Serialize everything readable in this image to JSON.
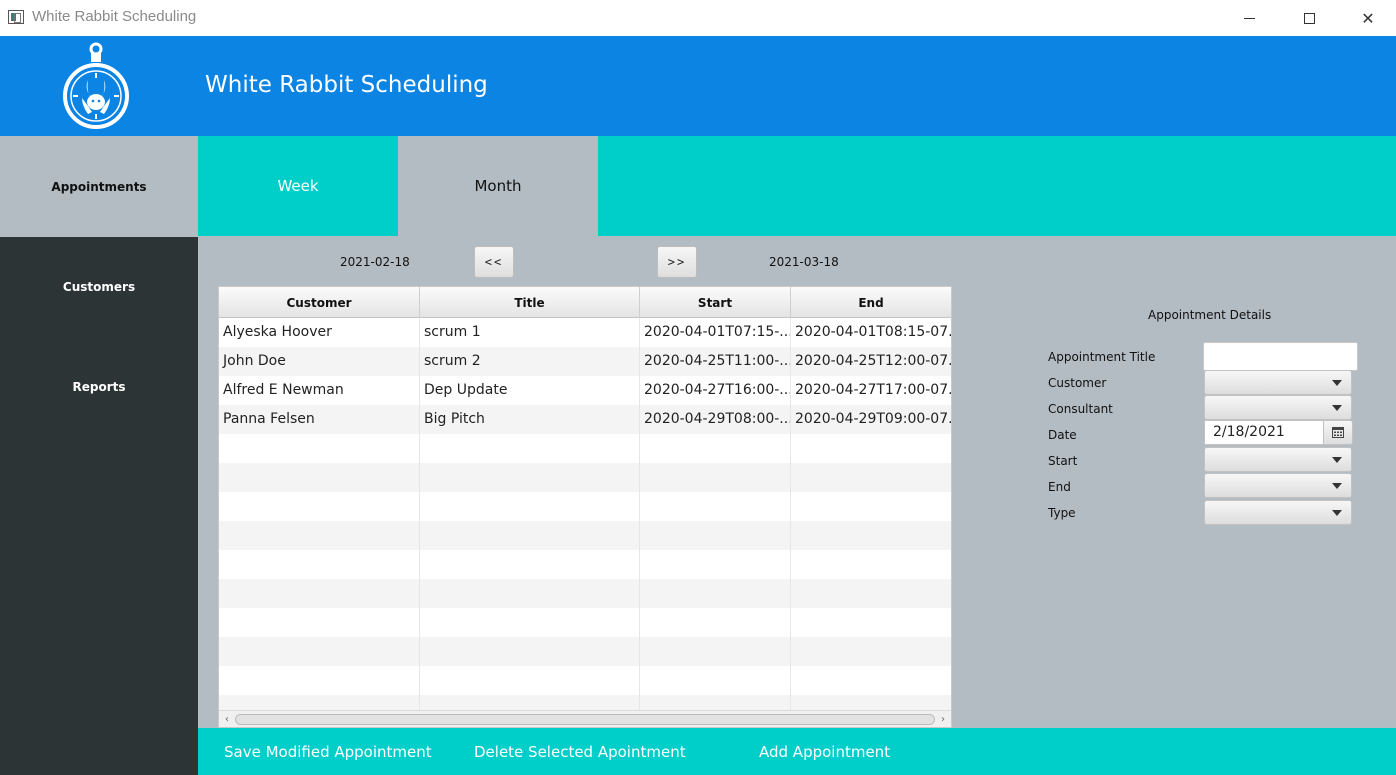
{
  "window": {
    "title": "White Rabbit Scheduling",
    "minimize_glyph": "—",
    "maximize_glyph": "☐",
    "close_glyph": "✕"
  },
  "header": {
    "title": "White Rabbit Scheduling",
    "logo_icon": "pocket-watch-rabbit-icon"
  },
  "sidebar": {
    "items": [
      {
        "label": "Appointments"
      },
      {
        "label": "Customers"
      },
      {
        "label": "Reports"
      }
    ]
  },
  "tabs": [
    {
      "label": "Week"
    },
    {
      "label": "Month"
    }
  ],
  "range": {
    "start": "2021-02-18",
    "end": "2021-03-18",
    "prev_label": "<<",
    "next_label": ">>"
  },
  "table": {
    "columns": [
      "Customer",
      "Title",
      "Start",
      "End"
    ],
    "rows": [
      [
        "Alyeska Hoover",
        "scrum 1",
        "2020-04-01T07:15-...",
        "2020-04-01T08:15-07..."
      ],
      [
        "John Doe",
        "scrum 2",
        "2020-04-25T11:00-...",
        "2020-04-25T12:00-07..."
      ],
      [
        "Alfred E Newman",
        "Dep Update",
        "2020-04-27T16:00-...",
        "2020-04-27T17:00-07..."
      ],
      [
        "Panna Felsen",
        "Big Pitch",
        "2020-04-29T08:00-...",
        "2020-04-29T09:00-07..."
      ]
    ],
    "scroll_left_glyph": "‹",
    "scroll_right_glyph": "›"
  },
  "details": {
    "title": "Appointment Details",
    "labels": {
      "appointment_title": "Appointment Title",
      "customer": "Customer",
      "consultant": "Consultant",
      "date": "Date",
      "start": "Start",
      "end": "End",
      "type": "Type"
    },
    "appointment_title_value": "",
    "date_value": "2/18/2021"
  },
  "footer": {
    "save": "Save Modified Appointment",
    "delete": "Delete Selected Apointment",
    "add": "Add Appointment"
  },
  "colors": {
    "header_blue": "#0c84e4",
    "accent_teal": "#00cec9",
    "sidebar_dark": "#2d3436",
    "content_gray": "#b3bcc2"
  }
}
